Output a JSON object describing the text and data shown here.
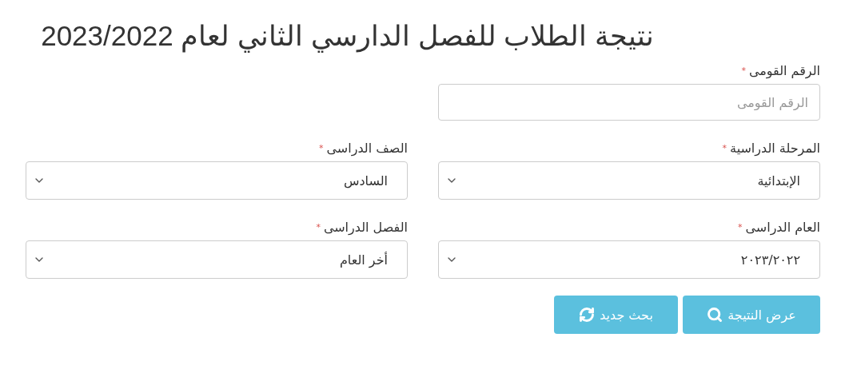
{
  "title": "نتيجة الطلاب للفصل الدارسي الثاني لعام 2023/2022",
  "rows": [
    [
      {
        "kind": "input",
        "label": "الرقم القومى",
        "marker": "*",
        "placeholder": "الرقم القومى"
      }
    ],
    [
      {
        "kind": "select",
        "label": "المرحلة الدراسية",
        "marker": "*",
        "value": "الإبتدائية"
      },
      {
        "kind": "select",
        "label": "الصف الدراسى",
        "marker": "*",
        "value": "السادس"
      }
    ],
    [
      {
        "kind": "select",
        "label": "العام الدراسى",
        "marker": "*",
        "value": "٢٠٢٣/٢٠٢٢"
      },
      {
        "kind": "select",
        "label": "الفصل الدراسى",
        "marker": "*",
        "value": "أخر العام"
      }
    ]
  ],
  "buttons": [
    {
      "label": "عرض النتيجة"
    },
    {
      "label": "بحث جديد"
    }
  ]
}
